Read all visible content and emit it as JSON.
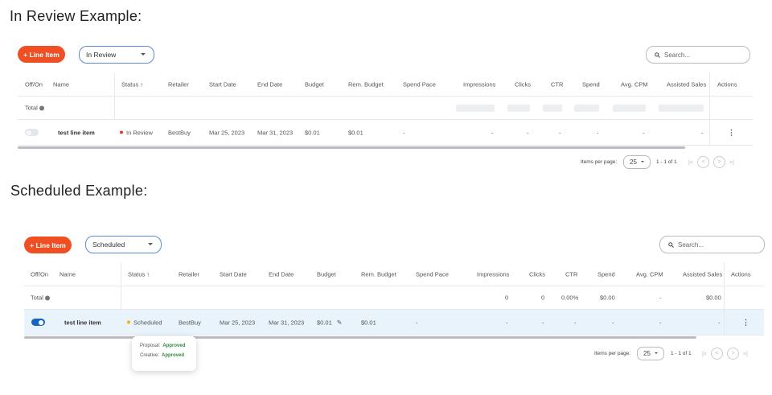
{
  "headings": {
    "review": "In Review Example:",
    "scheduled": "Scheduled Example:"
  },
  "colors": {
    "accent": "#f04e23",
    "in_review_dot": "#e53935",
    "scheduled_dot": "#f4b400",
    "toggle_on": "#1565c0",
    "selected_row": "#e8f3fb",
    "approved": "#2e8b3e"
  },
  "columns": [
    "Off/On",
    "Name",
    "Status",
    "Retailer",
    "Start Date",
    "End Date",
    "Budget",
    "Rem. Budget",
    "Spend Pace",
    "Impressions",
    "Clicks",
    "CTR",
    "Spend",
    "Avg. CPM",
    "Assisted Sales",
    "Actions"
  ],
  "sort_icon": "arrow-up-icon",
  "panel1": {
    "add_button": "+ Line Item",
    "filter": "In Review",
    "search_placeholder": "Search...",
    "total_label": "Total",
    "row": {
      "toggle": "off",
      "name": "test line item",
      "status": "In Review",
      "retailer": "BestBuy",
      "start": "Mar 25, 2023",
      "end": "Mar 31, 2023",
      "budget": "$0.01",
      "rem_budget": "$0.01",
      "spend_pace": "-",
      "impressions": "-",
      "clicks": "-",
      "ctr": "-",
      "spend": "-",
      "avg_cpm": "-",
      "assisted_sales": "-",
      "actions": "⋮"
    },
    "pager": {
      "items_per_page_label": "Items per page:",
      "per_page": "25",
      "range": "1 - 1 of 1"
    }
  },
  "panel2": {
    "add_button": "+ Line Item",
    "filter": "Scheduled",
    "search_placeholder": "Search...",
    "total": {
      "label": "Total",
      "impressions": "0",
      "clicks": "0",
      "ctr": "0.00%",
      "spend": "$0.00",
      "avg_cpm": "-",
      "assisted_sales": "$0.00"
    },
    "row": {
      "toggle": "on",
      "name": "test line item",
      "status": "Scheduled",
      "retailer": "BestBuy",
      "start": "Mar 25, 2023",
      "end": "Mar 31, 2023",
      "budget": "$0.01",
      "rem_budget": "$0.01",
      "spend_pace": "-",
      "impressions": "-",
      "clicks": "-",
      "ctr": "-",
      "spend": "-",
      "avg_cpm": "-",
      "assisted_sales": "-",
      "actions": "⋮"
    },
    "tooltip": {
      "proposal_label": "Proposal:",
      "proposal_value": "Approved",
      "creative_label": "Creative:",
      "creative_value": "Approved"
    },
    "pager": {
      "items_per_page_label": "Items per page:",
      "per_page": "25",
      "range": "1 - 1 of 1"
    }
  }
}
